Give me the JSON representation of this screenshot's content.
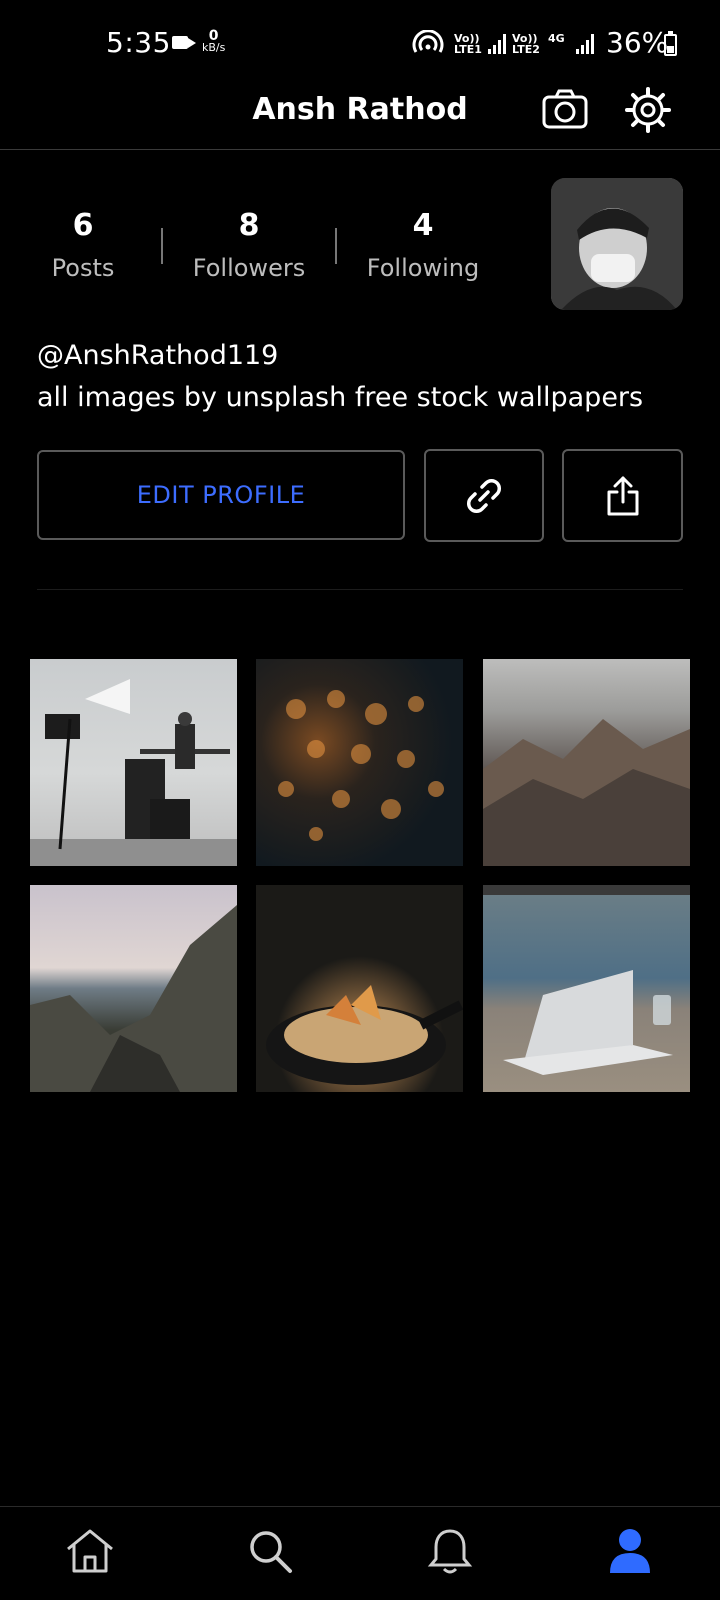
{
  "status_bar": {
    "time": "5:35",
    "speed_value": "0",
    "speed_unit": "kB/s",
    "sim1_top": "Vo))",
    "sim1_bottom": "LTE1",
    "sim2_top": "Vo))",
    "sim2_bottom": "LTE2",
    "network_type": "4G",
    "battery_percent": "36%"
  },
  "header": {
    "title": "Ansh Rathod",
    "camera_icon": "camera-icon",
    "settings_icon": "gear-icon"
  },
  "profile": {
    "stats": [
      {
        "value": "6",
        "label": "Posts"
      },
      {
        "value": "8",
        "label": "Followers"
      },
      {
        "value": "4",
        "label": "Following"
      }
    ],
    "handle": "@AnshRathod119",
    "bio": "all images by unsplash free stock wallpapers",
    "edit_button_label": "EDIT PROFILE",
    "link_icon": "link-icon",
    "share_icon": "share-icon"
  },
  "posts": [
    {
      "name": "studio-setup"
    },
    {
      "name": "bokeh-lights"
    },
    {
      "name": "misty-mountains"
    },
    {
      "name": "coastal-rocks"
    },
    {
      "name": "food-pan"
    },
    {
      "name": "laptop-table"
    }
  ],
  "bottom_nav": {
    "items": [
      "home-icon",
      "search-icon",
      "bell-icon",
      "profile-icon"
    ],
    "active": "profile-icon",
    "accent_color": "#2f6bff"
  },
  "colors": {
    "background": "#000000",
    "edit_text": "#3d6dff",
    "secondary_text": "#bdbdbd"
  }
}
